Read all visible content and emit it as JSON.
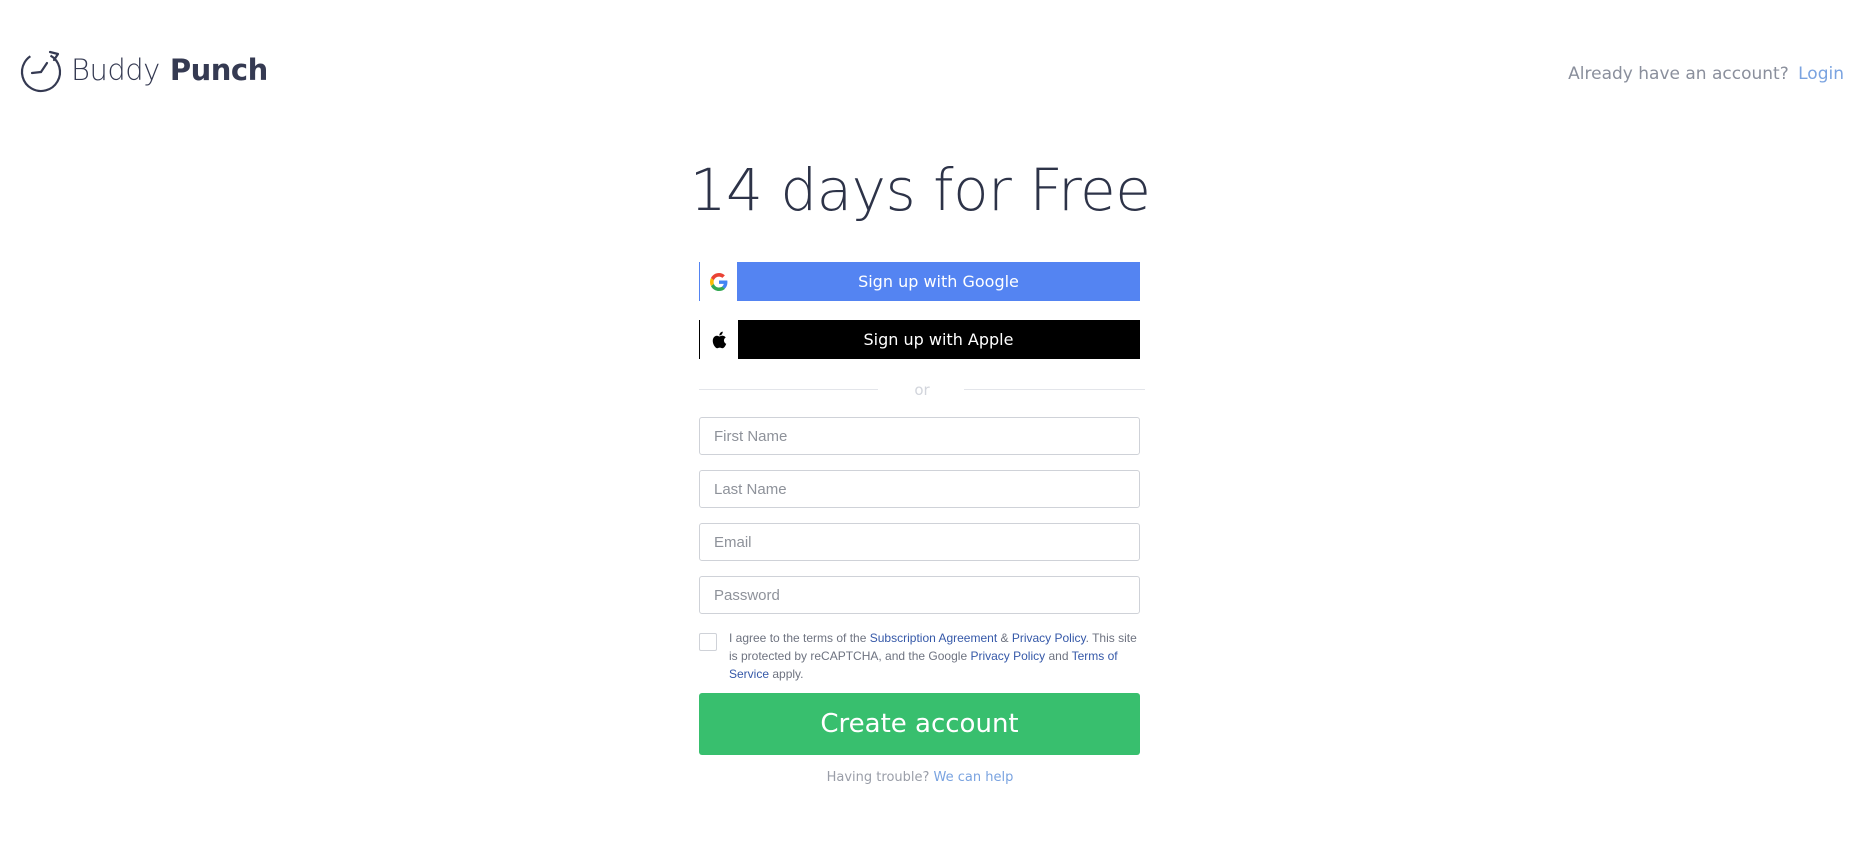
{
  "header": {
    "logo_word1": "Buddy",
    "logo_word2": "Punch",
    "login_prompt": "Already have an account?",
    "login_link": "Login"
  },
  "title": "14 days for Free",
  "social": {
    "google_label": "Sign up with Google",
    "apple_label": "Sign up with Apple"
  },
  "divider_text": "or",
  "form": {
    "first_name_placeholder": "First Name",
    "last_name_placeholder": "Last Name",
    "email_placeholder": "Email",
    "password_placeholder": "Password",
    "terms": {
      "part1": "I agree to the terms of the ",
      "link_subscription": "Subscription Agreement",
      "part2": " & ",
      "link_privacy1": "Privacy Policy",
      "part3": ". This site is protected by reCAPTCHA, and the Google ",
      "link_privacy2": "Privacy Policy",
      "part4": " and ",
      "link_terms": "Terms of Service",
      "part5": " apply."
    },
    "submit_label": "Create account"
  },
  "help": {
    "text": "Having trouble?",
    "link": "We can help"
  },
  "colors": {
    "google_blue": "#5484f2",
    "apple_black": "#000000",
    "create_green": "#38bf6e",
    "link_blue": "#7aa3e0",
    "terms_link": "#3558a8"
  },
  "icons": [
    "buddy-punch-logo-icon",
    "google-icon",
    "apple-icon"
  ]
}
